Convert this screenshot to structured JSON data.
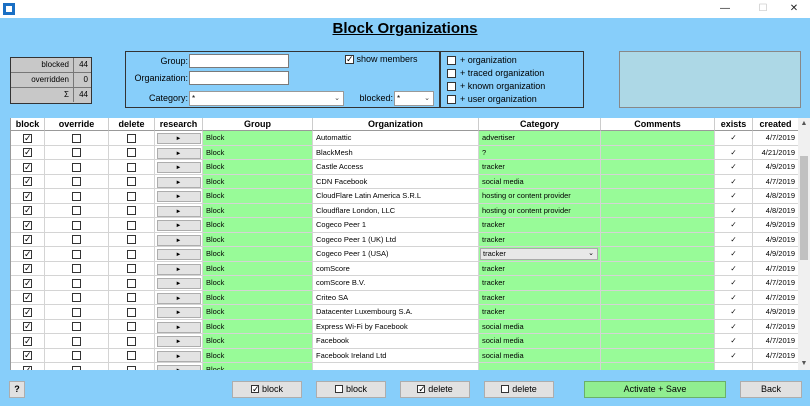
{
  "window": {
    "minimize": "—",
    "maximize": "☐",
    "close": "✕"
  },
  "page_title": "Block Organizations",
  "stats": [
    {
      "label": "blocked",
      "value": "44"
    },
    {
      "label": "overridden",
      "value": "0"
    },
    {
      "label": "Σ",
      "value": "44"
    }
  ],
  "filter": {
    "group_label": "Group:",
    "group_value": "",
    "org_label": "Organization:",
    "org_value": "",
    "category_label": "Category:",
    "category_value": "*",
    "show_members_label": "show members",
    "show_members_checked": true,
    "blocked_label": "blocked:",
    "blocked_value": "*"
  },
  "plus_options": [
    {
      "label": "+ organization",
      "checked": false
    },
    {
      "label": "+ traced organization",
      "checked": false
    },
    {
      "label": "+ known organization",
      "checked": false
    },
    {
      "label": "+ user organization",
      "checked": false
    }
  ],
  "columns": [
    "block",
    "override",
    "delete",
    "research",
    "Group",
    "Organization",
    "Category",
    "Comments",
    "exists",
    "created"
  ],
  "research_button_label": "►",
  "rows": [
    {
      "group": "Block",
      "organization": "Automattic",
      "category": "advertiser",
      "exists": "✓",
      "created": "4/7/2019"
    },
    {
      "group": "Block",
      "organization": "BlackMesh",
      "category": "?",
      "exists": "✓",
      "created": "4/21/2019"
    },
    {
      "group": "Block",
      "organization": "Castle Access",
      "category": "tracker",
      "exists": "✓",
      "created": "4/9/2019"
    },
    {
      "group": "Block",
      "organization": "CDN Facebook",
      "category": "social media",
      "exists": "✓",
      "created": "4/7/2019"
    },
    {
      "group": "Block",
      "organization": "CloudFlare Latin America S.R.L",
      "category": "hosting or content provider",
      "exists": "✓",
      "created": "4/8/2019"
    },
    {
      "group": "Block",
      "organization": "Cloudflare London, LLC",
      "category": "hosting or content provider",
      "exists": "✓",
      "created": "4/8/2019"
    },
    {
      "group": "Block",
      "organization": "Cogeco Peer 1",
      "category": "tracker",
      "exists": "✓",
      "created": "4/9/2019"
    },
    {
      "group": "Block",
      "organization": "Cogeco Peer 1 (UK) Ltd",
      "category": "tracker",
      "exists": "✓",
      "created": "4/9/2019"
    },
    {
      "group": "Block",
      "organization": "Cogeco Peer 1 (USA)",
      "category": "tracker",
      "exists": "✓",
      "created": "4/9/2019",
      "dropdown": true
    },
    {
      "group": "Block",
      "organization": "comScore",
      "category": "tracker",
      "exists": "✓",
      "created": "4/7/2019"
    },
    {
      "group": "Block",
      "organization": "comScore B.V.",
      "category": "tracker",
      "exists": "✓",
      "created": "4/7/2019"
    },
    {
      "group": "Block",
      "organization": "Criteo SA",
      "category": "tracker",
      "exists": "✓",
      "created": "4/7/2019"
    },
    {
      "group": "Block",
      "organization": "Datacenter Luxembourg S.A.",
      "category": "tracker",
      "exists": "✓",
      "created": "4/9/2019"
    },
    {
      "group": "Block",
      "organization": "Express Wi-Fi by Facebook",
      "category": "social media",
      "exists": "✓",
      "created": "4/7/2019"
    },
    {
      "group": "Block",
      "organization": "Facebook",
      "category": "social media",
      "exists": "✓",
      "created": "4/7/2019"
    },
    {
      "group": "Block",
      "organization": "Facebook Ireland Ltd",
      "category": "social media",
      "exists": "✓",
      "created": "4/7/2019"
    },
    {
      "group": "Block",
      "organization": "",
      "category": "",
      "exists": "",
      "created": ""
    }
  ],
  "buttons": {
    "help": "?",
    "block_checked": "block",
    "block_unchecked": "block",
    "delete_checked": "delete",
    "delete_unchecked": "delete",
    "activate_save": "Activate + Save",
    "back": "Back"
  }
}
